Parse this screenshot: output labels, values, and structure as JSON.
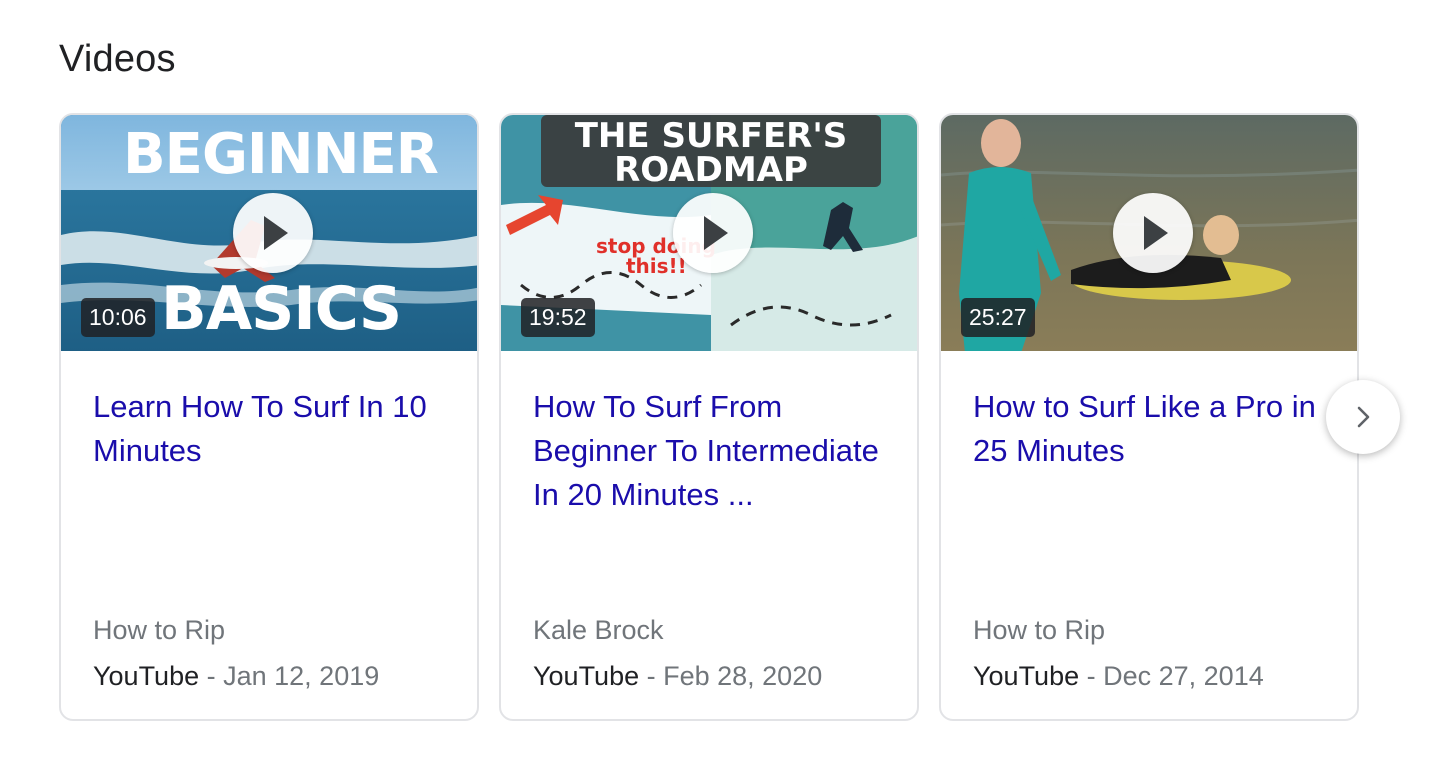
{
  "section": {
    "title": "Videos"
  },
  "videos": [
    {
      "title": "Learn How To Surf In 10 Minutes",
      "duration": "10:06",
      "channel": "How to Rip",
      "source": "YouTube",
      "date": "Jan 12, 2019",
      "thumbnail_text": [
        "BEGINNER",
        "BASICS"
      ]
    },
    {
      "title": "How To Surf From Beginner To Intermediate In 20 Minutes ...",
      "duration": "19:52",
      "channel": "Kale Brock",
      "source": "YouTube",
      "date": "Feb 28, 2020",
      "thumbnail_text": [
        "THE SURFER'S",
        "ROADMAP",
        "stop doing",
        "this!!"
      ]
    },
    {
      "title": "How to Surf Like a Pro in 25 Minutes",
      "duration": "25:27",
      "channel": "How to Rip",
      "source": "YouTube",
      "date": "Dec 27, 2014",
      "thumbnail_text": []
    }
  ],
  "controls": {
    "play_icon": "play-icon",
    "next_icon": "chevron-right-icon"
  },
  "colors": {
    "link": "#1a0dab",
    "muted": "#70757a",
    "text": "#202124"
  }
}
